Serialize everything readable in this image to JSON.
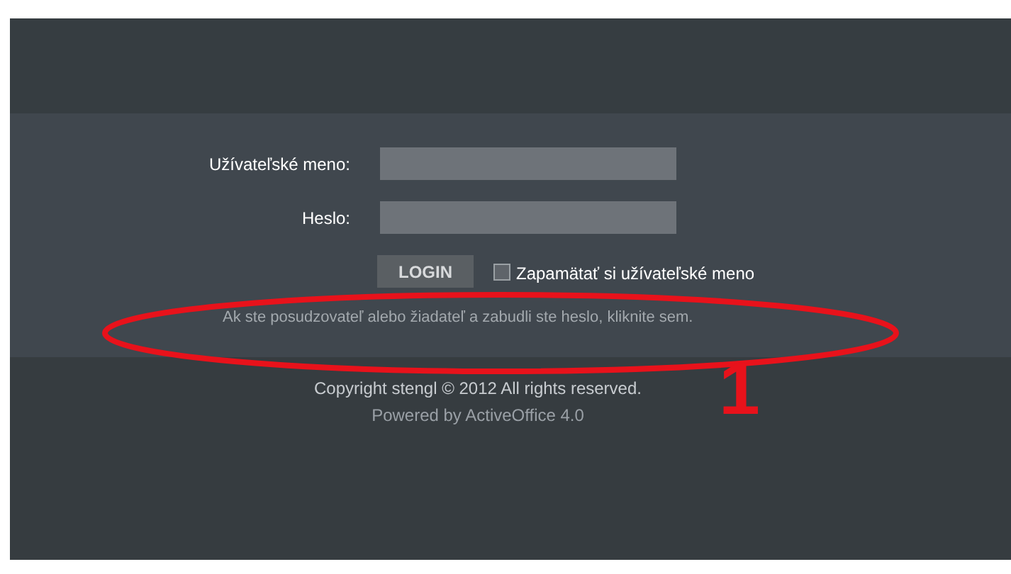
{
  "login_form": {
    "username_label": "Užívateľské meno:",
    "password_label": "Heslo:",
    "login_button": "LOGIN",
    "remember": {
      "label": "Zapamätať si užívateľské meno",
      "checked": false
    },
    "forgot_link": "Ak ste posudzovateľ alebo žiadateľ a zabudli ste heslo, kliknite sem."
  },
  "footer": {
    "copyright": "Copyright stengl © 2012 All rights reserved.",
    "powered_by": "Powered by ActiveOffice 4.0"
  },
  "annotation": {
    "number": "1"
  }
}
